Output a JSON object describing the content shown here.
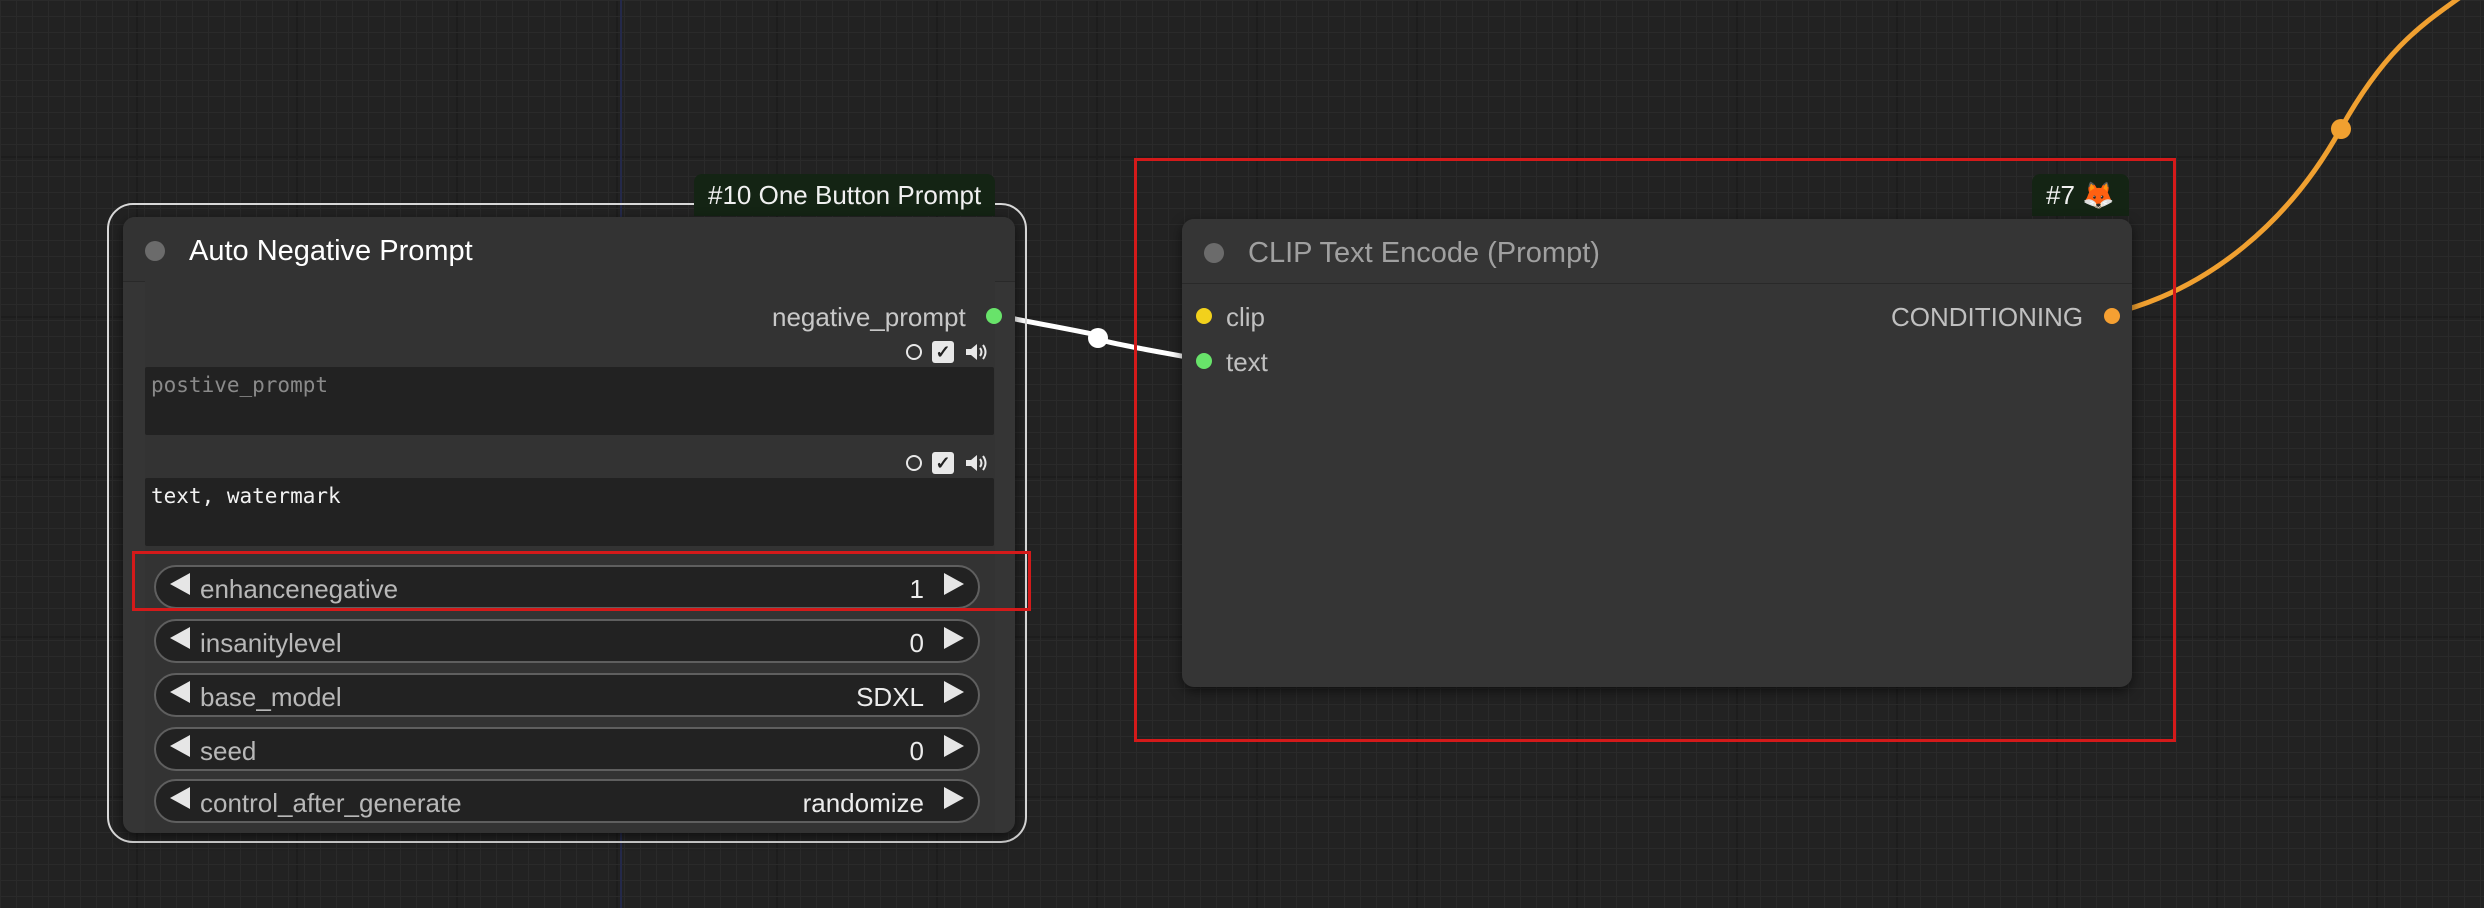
{
  "canvas": {
    "background": "#222222"
  },
  "colors": {
    "clip_slot": "#f2d11c",
    "text_slot": "#68e36a",
    "string_output_slot": "#68e36a",
    "conditioning_slot": "#f5a032",
    "conditioning_link": "#f0a030",
    "string_link": "#ffffff",
    "highlight": "#d41a1a",
    "badge_bg": "#142414"
  },
  "left_node": {
    "badge": "#10 One Button Prompt",
    "title": "Auto Negative Prompt",
    "output": {
      "label": "negative_prompt",
      "icon": "green-slot-dot"
    },
    "text_inputs": [
      {
        "name": "postive_prompt",
        "value": "",
        "placeholder": "postive_prompt",
        "icons": [
          "circle-icon",
          "checkbox-icon",
          "speaker-icon"
        ]
      },
      {
        "name": "negative",
        "value": "text, watermark",
        "placeholder": "",
        "icons": [
          "circle-icon",
          "checkbox-icon",
          "speaker-icon"
        ]
      }
    ],
    "widgets": [
      {
        "label": "enhancenegative",
        "value": "1"
      },
      {
        "label": "insanitylevel",
        "value": "0"
      },
      {
        "label": "base_model",
        "value": "SDXL"
      },
      {
        "label": "seed",
        "value": "0"
      },
      {
        "label": "control_after_generate",
        "value": "randomize"
      }
    ]
  },
  "right_node": {
    "badge": "#7 🦊",
    "title": "CLIP Text Encode (Prompt)",
    "inputs": [
      {
        "label": "clip"
      },
      {
        "label": "text"
      }
    ],
    "output": {
      "label": "CONDITIONING"
    }
  }
}
